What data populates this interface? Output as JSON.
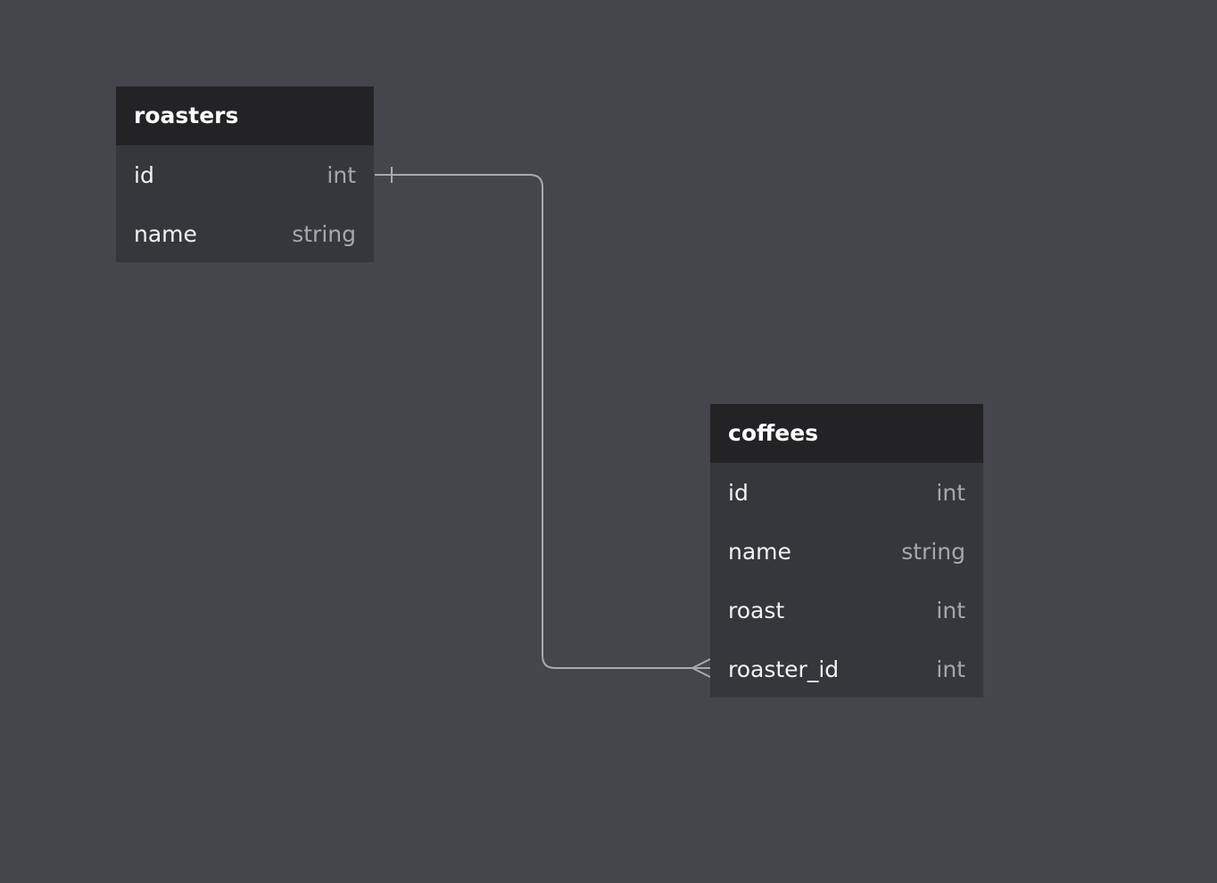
{
  "entities": {
    "roasters": {
      "title": "roasters",
      "fields": [
        {
          "name": "id",
          "type": "int"
        },
        {
          "name": "name",
          "type": "string"
        }
      ]
    },
    "coffees": {
      "title": "coffees",
      "fields": [
        {
          "name": "id",
          "type": "int"
        },
        {
          "name": "name",
          "type": "string"
        },
        {
          "name": "roast",
          "type": "int"
        },
        {
          "name": "roaster_id",
          "type": "int"
        }
      ]
    }
  },
  "relationships": [
    {
      "from": "roasters.id",
      "from_cardinality": "one",
      "to": "coffees.roaster_id",
      "to_cardinality": "many"
    }
  ],
  "colors": {
    "canvas": "#45464b",
    "header": "#232325",
    "body": "#36373b",
    "connector": "#a9aaae"
  }
}
